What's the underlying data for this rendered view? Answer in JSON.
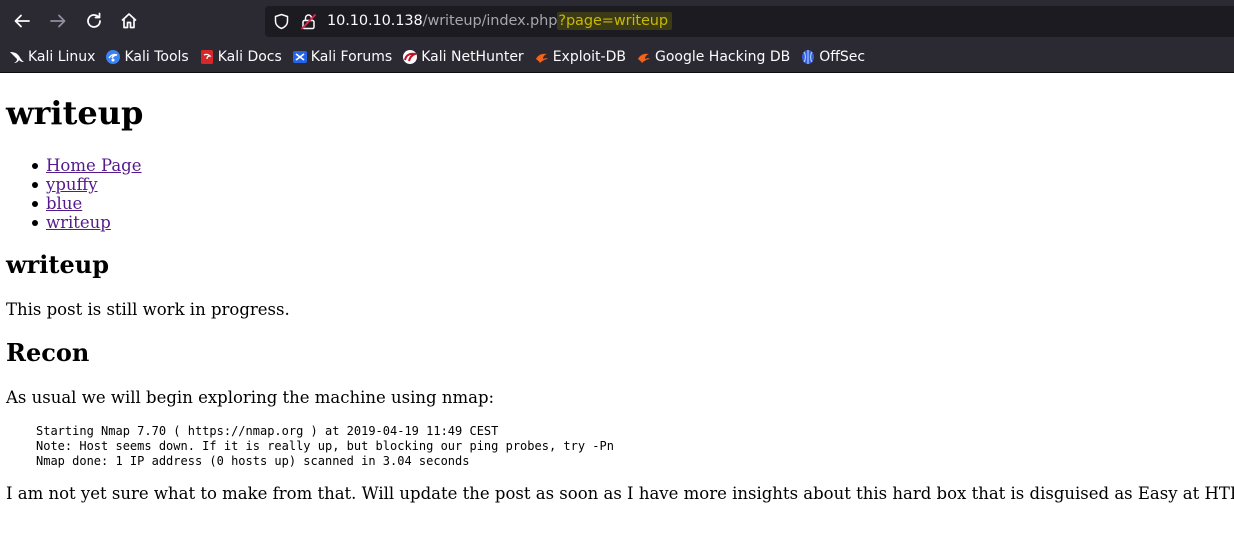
{
  "browser": {
    "url": {
      "host": "10.10.10.138",
      "path": "/writeup/index.php",
      "query": "?page=writeup"
    },
    "bookmarks": [
      {
        "label": "Kali Linux",
        "icon": "kali-dragon-icon"
      },
      {
        "label": "Kali Tools",
        "icon": "kali-tools-icon"
      },
      {
        "label": "Kali Docs",
        "icon": "kali-docs-icon"
      },
      {
        "label": "Kali Forums",
        "icon": "kali-forums-icon"
      },
      {
        "label": "Kali NetHunter",
        "icon": "nethunter-icon"
      },
      {
        "label": "Exploit-DB",
        "icon": "exploit-db-icon"
      },
      {
        "label": "Google Hacking DB",
        "icon": "ghdb-icon"
      },
      {
        "label": "OffSec",
        "icon": "offsec-icon"
      }
    ]
  },
  "page": {
    "site_title": "writeup",
    "nav": [
      {
        "label": "Home Page"
      },
      {
        "label": "ypuffy"
      },
      {
        "label": "blue"
      },
      {
        "label": "writeup"
      }
    ],
    "post_title": "writeup",
    "intro": "This post is still work in progress.",
    "section_title": "Recon",
    "section_text": "As usual we will begin exploring the machine using nmap:",
    "code_lines": [
      "Starting Nmap 7.70 ( https://nmap.org ) at 2019-04-19 11:49 CEST",
      "Note: Host seems down. If it is really up, but blocking our ping probes, try -Pn",
      "Nmap done: 1 IP address (0 hosts up) scanned in 3.04 seconds"
    ],
    "closing": "I am not yet sure what to make from that. Will update the post as soon as I have more insights about this hard box that is disguised as Easy at HTB."
  },
  "colors": {
    "chrome_bg": "#2b2a33",
    "urlbar_bg": "#1c1b22",
    "query_highlight": "#c9b900",
    "visited_link": "#551a8b"
  }
}
